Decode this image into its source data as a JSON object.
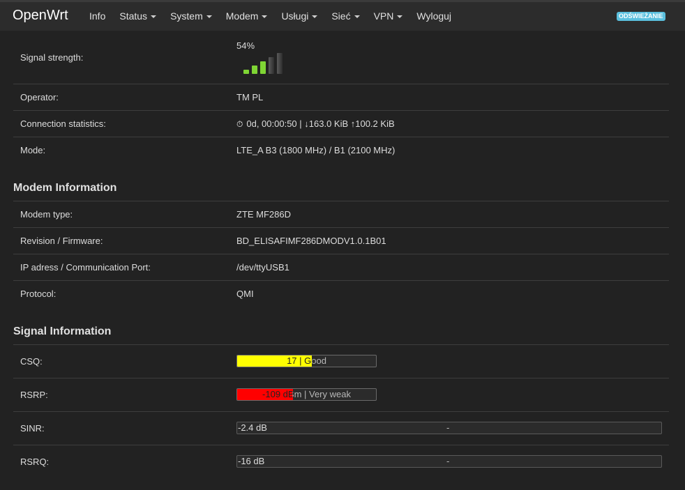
{
  "nav": {
    "brand": "OpenWrt",
    "items": [
      {
        "label": "Info"
      },
      {
        "label": "Status"
      },
      {
        "label": "System"
      },
      {
        "label": "Modem"
      },
      {
        "label": "Usługi"
      },
      {
        "label": "Sieć"
      },
      {
        "label": "VPN"
      },
      {
        "label": "Wyloguj"
      }
    ],
    "refresh_label": "ODŚWIEŻANIE"
  },
  "connection": {
    "signal_label": "Signal strength:",
    "signal_value": "54%",
    "signal_bars": {
      "active": 3,
      "total": 5,
      "active_color": "#7fd534",
      "inactive_color": "#5a5a5a"
    },
    "operator_label": "Operator:",
    "operator_value": "TM PL",
    "stats_label": "Connection statistics:",
    "stats_icon": "stopwatch-icon",
    "stats_value": "0d, 00:00:50 | ↓163.0 KiB ↑100.2 KiB",
    "mode_label": "Mode:",
    "mode_value": "LTE_A B3 (1800 MHz) / B1 (2100 MHz)"
  },
  "modem": {
    "title": "Modem Information",
    "type_label": "Modem type:",
    "type_value": "ZTE MF286D",
    "firmware_label": "Revision / Firmware:",
    "firmware_value": "BD_ELISAFIMF286DMODV1.0.1B01",
    "port_label": "IP adress / Communication Port:",
    "port_value": "/dev/ttyUSB1",
    "protocol_label": "Protocol:",
    "protocol_value": "QMI"
  },
  "signal": {
    "title": "Signal Information",
    "csq": {
      "label": "CSQ:",
      "text": "17 | Good",
      "percent": 54,
      "color": "#ffff00"
    },
    "rsrp": {
      "label": "RSRP:",
      "text": "-109 dBm | Very weak",
      "percent": 40,
      "color": "#ff0000"
    },
    "sinr": {
      "label": "SINR:",
      "left_text": "-2.4 dB",
      "right_text": "-"
    },
    "rsrq": {
      "label": "RSRQ:",
      "left_text": "-16 dB",
      "right_text": "-"
    }
  }
}
